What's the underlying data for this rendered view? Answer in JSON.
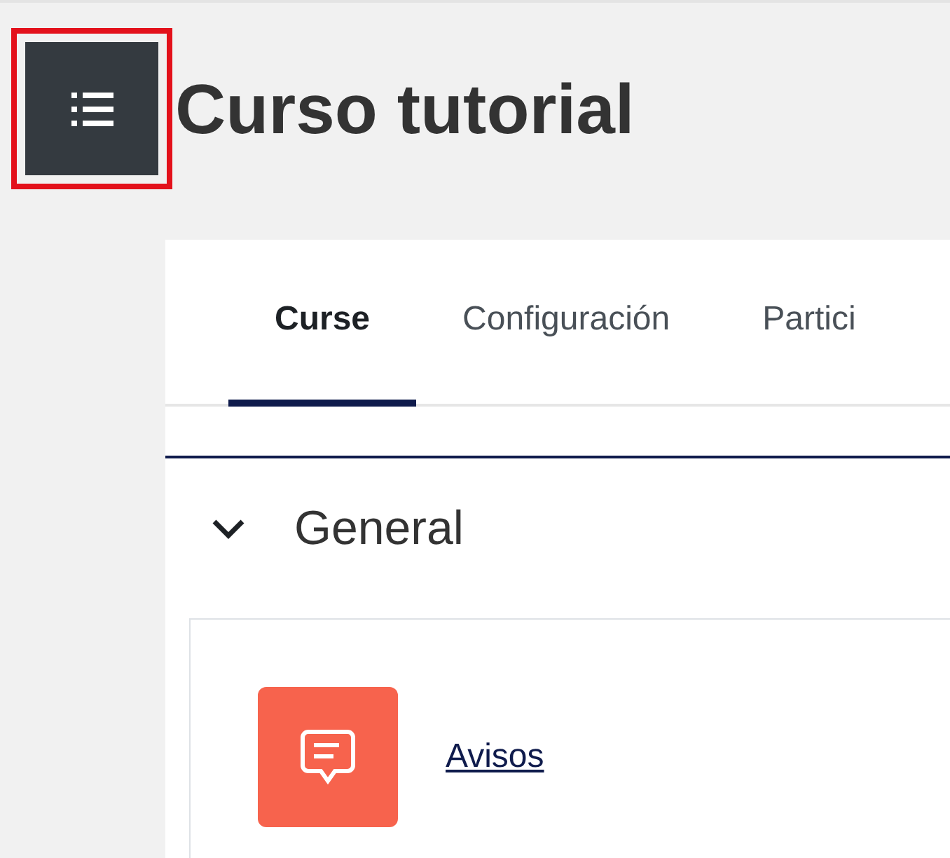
{
  "menu_button": {
    "highlighted": true
  },
  "title": "Curso tutorial",
  "tabs": [
    {
      "label": "Curse",
      "selected": true
    },
    {
      "label": "Configuración",
      "selected": false
    },
    {
      "label": "Partici",
      "selected": false
    }
  ],
  "section": {
    "title": "General",
    "expanded": true
  },
  "activities": [
    {
      "kind": "forum",
      "name": "Avisos"
    }
  ]
}
